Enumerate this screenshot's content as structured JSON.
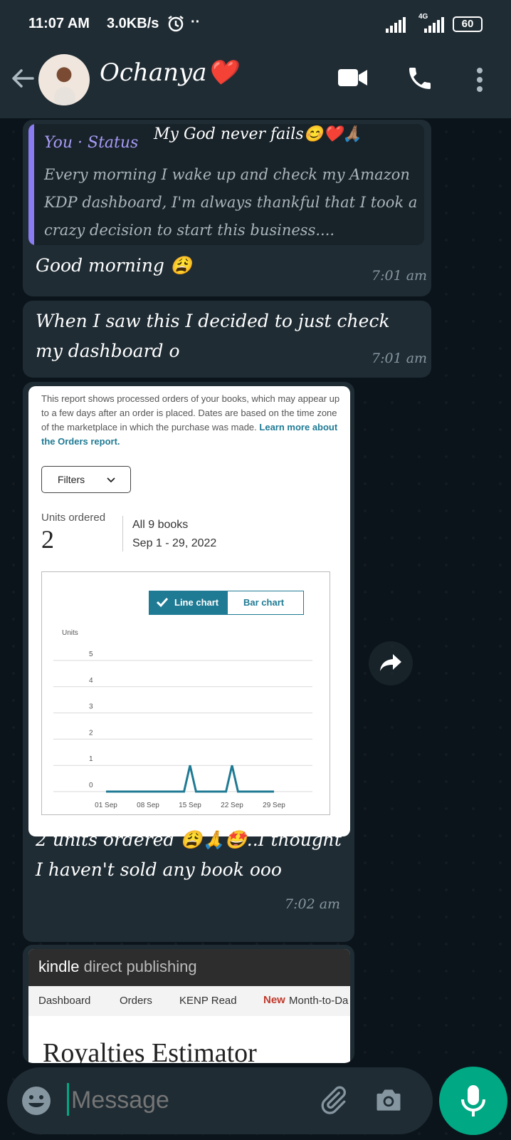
{
  "status_bar": {
    "time": "11:07 AM",
    "speed": "3.0KB/s",
    "network": "4G",
    "battery": "60"
  },
  "header": {
    "contact_name": "Ochanya❤️"
  },
  "messages": [
    {
      "quote_author": "You · Status",
      "quote_caption": "My God never fails😊❤️🙏🏽",
      "quote_text": "Every morning I wake up and check my Amazon KDP dashboard, I'm always thankful that I took a crazy decision to start this business....",
      "text": "Good morning 😩",
      "time": "7:01 am"
    },
    {
      "text": "When I saw this I decided to just check my dashboard o",
      "time": "7:01 am"
    },
    {
      "caption": "2 units ordered 😩🙏🤩..I thought I haven't sold any book ooo",
      "time": "7:02 am"
    }
  ],
  "orders_report": {
    "intro": "This report shows processed orders of your books, which may appear up to a few days after an order is placed. Dates are based on the time zone of the marketplace in which the purchase was made.",
    "learn_more": "Learn more about the Orders report.",
    "filters_label": "Filters",
    "units_label": "Units ordered",
    "units_value": "2",
    "books_label": "All 9 books",
    "date_range": "Sep 1 - 29, 2022",
    "toggle_line": "Line chart",
    "toggle_bar": "Bar chart"
  },
  "chart_data": {
    "type": "line",
    "ylabel": "Units",
    "x_ticks": [
      "01 Sep",
      "08 Sep",
      "15 Sep",
      "22 Sep",
      "29 Sep"
    ],
    "ylim": [
      0,
      5
    ],
    "y_ticks": [
      0,
      1,
      2,
      3,
      4,
      5
    ],
    "grid": true,
    "x": [
      "01 Sep",
      "02 Sep",
      "03 Sep",
      "04 Sep",
      "05 Sep",
      "06 Sep",
      "07 Sep",
      "08 Sep",
      "09 Sep",
      "10 Sep",
      "11 Sep",
      "12 Sep",
      "13 Sep",
      "14 Sep",
      "15 Sep",
      "16 Sep",
      "17 Sep",
      "18 Sep",
      "19 Sep",
      "20 Sep",
      "21 Sep",
      "22 Sep",
      "23 Sep",
      "24 Sep",
      "25 Sep",
      "26 Sep",
      "27 Sep",
      "28 Sep",
      "29 Sep"
    ],
    "series": [
      {
        "color": "#1f7a94",
        "values": [
          0,
          0,
          0,
          0,
          0,
          0,
          0,
          0,
          0,
          0,
          0,
          0,
          0,
          0,
          1,
          0,
          0,
          0,
          0,
          0,
          0,
          1,
          0,
          0,
          0,
          0,
          0,
          0,
          0
        ]
      }
    ]
  },
  "kdp_card": {
    "brand_bold": "kindle",
    "brand_rest": " direct publishing",
    "tabs": [
      "Dashboard",
      "Orders",
      "KENP Read"
    ],
    "new_badge": "New",
    "new_tab": "Month-to-Da",
    "heading": "Royalties Estimator"
  },
  "composer": {
    "placeholder": "Message"
  },
  "colors": {
    "accent": "#00a884",
    "bubble": "#1f2c34",
    "chart_line": "#1f7a94",
    "quote_bar": "#8a7cf0",
    "quote_author": "#a79bf5",
    "kdp_new": "#c0392b"
  }
}
